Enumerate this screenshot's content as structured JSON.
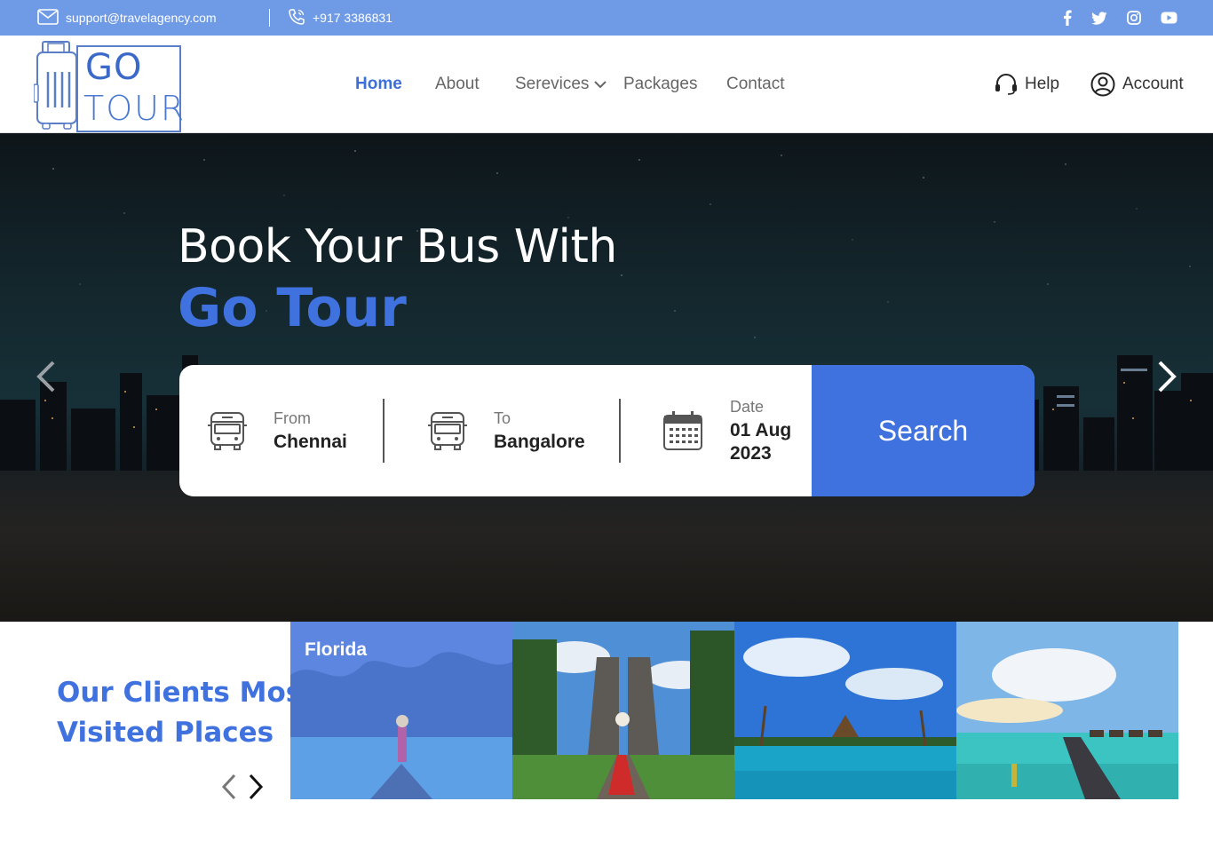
{
  "topbar": {
    "email": "support@travelagency.com",
    "phone": "+917 3386831",
    "social_icons": [
      "facebook-icon",
      "twitter-icon",
      "instagram-icon",
      "youtube-icon"
    ]
  },
  "logo": {
    "line1": "GO",
    "line2": "TOUR"
  },
  "nav": {
    "home": "Home",
    "about": "About",
    "services": "Serevices",
    "packages": "Packages",
    "contact": "Contact",
    "help": "Help",
    "account": "Account"
  },
  "hero": {
    "title_line1": "Book Your Bus With",
    "title_line2": "Go Tour"
  },
  "search": {
    "from_label": "From",
    "from_value": "Chennai",
    "to_label": "To",
    "to_value": "Bangalore",
    "date_label": "Date",
    "date_value_line1": "01 Aug",
    "date_value_line2": "2023",
    "button": "Search"
  },
  "visited": {
    "title_line1": "Our Clients Most",
    "title_line2": "Visited Places",
    "places": [
      {
        "label": "Florida"
      },
      {
        "label": ""
      },
      {
        "label": ""
      },
      {
        "label": ""
      }
    ]
  },
  "colors": {
    "topbar": "#6f9be6",
    "accent": "#3f72de",
    "hero_bg": "#13262c"
  }
}
